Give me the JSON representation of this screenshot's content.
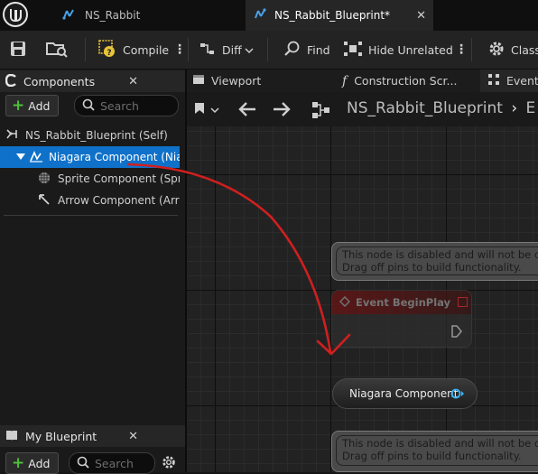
{
  "tabs": [
    {
      "label": "NS_Rabbit",
      "close": ""
    },
    {
      "label": "NS_Rabbit_Blueprint*",
      "close": "✕"
    }
  ],
  "toolbar": {
    "compile": "Compile",
    "diff": "Diff",
    "find": "Find",
    "hide_unrelated": "Hide Unrelated",
    "class": "Class"
  },
  "components_panel": {
    "title": "Components",
    "close": "✕",
    "add": "Add",
    "search_placeholder": "Search",
    "tree": [
      {
        "label": "NS_Rabbit_Blueprint (Self)"
      },
      {
        "label": "Niagara Component (Niag",
        "selected": true
      },
      {
        "label": "Sprite Component (Sprit"
      },
      {
        "label": "Arrow Component (Arro"
      }
    ]
  },
  "my_blueprint_panel": {
    "title": "My Blueprint",
    "close": "✕",
    "add": "Add",
    "search_placeholder": "Search"
  },
  "editor_tabs": [
    {
      "label": "Viewport"
    },
    {
      "label": "Construction Scr..."
    },
    {
      "label": "Event G"
    }
  ],
  "graph_nav": {
    "breadcrumb": "NS_Rabbit_Blueprint",
    "next": "E"
  },
  "graph": {
    "comment1": [
      "This node is disabled and will not be ca",
      "Drag off pins to build functionality."
    ],
    "event_node": "Event BeginPlay",
    "component_node": "Niagara Component",
    "comment2": [
      "This node is disabled and will not be ca",
      "Drag off pins to build functionality."
    ]
  },
  "colors": {
    "selection": "#0f71c9",
    "annotation": "#d01f1f",
    "add_plus": "#4fbf3a",
    "event_header": "#5a1414",
    "pin_blue": "#37b5ff"
  }
}
